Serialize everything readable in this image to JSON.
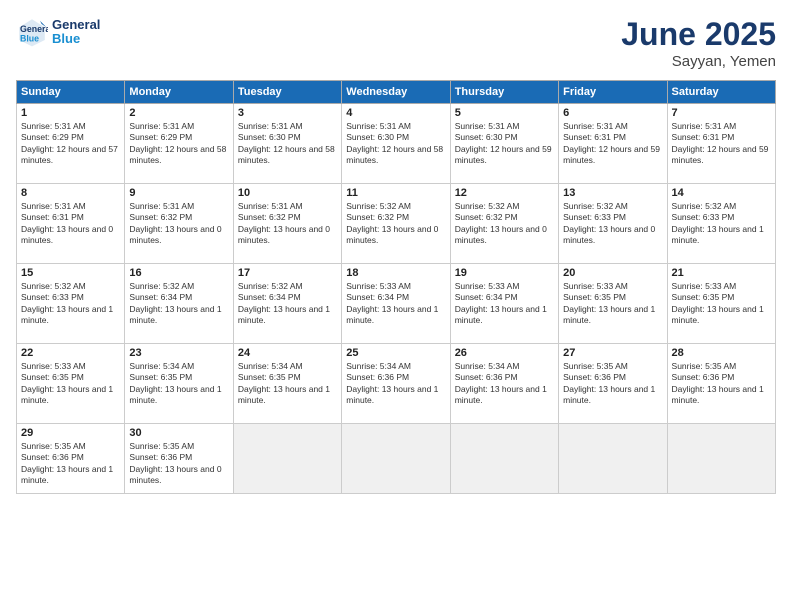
{
  "logo": {
    "line1": "General",
    "line2": "Blue"
  },
  "title": "June 2025",
  "location": "Sayyan, Yemen",
  "days_of_week": [
    "Sunday",
    "Monday",
    "Tuesday",
    "Wednesday",
    "Thursday",
    "Friday",
    "Saturday"
  ],
  "weeks": [
    [
      {
        "day": "1",
        "sunrise": "5:31 AM",
        "sunset": "6:29 PM",
        "daylight": "12 hours and 57 minutes."
      },
      {
        "day": "2",
        "sunrise": "5:31 AM",
        "sunset": "6:29 PM",
        "daylight": "12 hours and 58 minutes."
      },
      {
        "day": "3",
        "sunrise": "5:31 AM",
        "sunset": "6:30 PM",
        "daylight": "12 hours and 58 minutes."
      },
      {
        "day": "4",
        "sunrise": "5:31 AM",
        "sunset": "6:30 PM",
        "daylight": "12 hours and 58 minutes."
      },
      {
        "day": "5",
        "sunrise": "5:31 AM",
        "sunset": "6:30 PM",
        "daylight": "12 hours and 59 minutes."
      },
      {
        "day": "6",
        "sunrise": "5:31 AM",
        "sunset": "6:31 PM",
        "daylight": "12 hours and 59 minutes."
      },
      {
        "day": "7",
        "sunrise": "5:31 AM",
        "sunset": "6:31 PM",
        "daylight": "12 hours and 59 minutes."
      }
    ],
    [
      {
        "day": "8",
        "sunrise": "5:31 AM",
        "sunset": "6:31 PM",
        "daylight": "13 hours and 0 minutes."
      },
      {
        "day": "9",
        "sunrise": "5:31 AM",
        "sunset": "6:32 PM",
        "daylight": "13 hours and 0 minutes."
      },
      {
        "day": "10",
        "sunrise": "5:31 AM",
        "sunset": "6:32 PM",
        "daylight": "13 hours and 0 minutes."
      },
      {
        "day": "11",
        "sunrise": "5:32 AM",
        "sunset": "6:32 PM",
        "daylight": "13 hours and 0 minutes."
      },
      {
        "day": "12",
        "sunrise": "5:32 AM",
        "sunset": "6:32 PM",
        "daylight": "13 hours and 0 minutes."
      },
      {
        "day": "13",
        "sunrise": "5:32 AM",
        "sunset": "6:33 PM",
        "daylight": "13 hours and 0 minutes."
      },
      {
        "day": "14",
        "sunrise": "5:32 AM",
        "sunset": "6:33 PM",
        "daylight": "13 hours and 1 minute."
      }
    ],
    [
      {
        "day": "15",
        "sunrise": "5:32 AM",
        "sunset": "6:33 PM",
        "daylight": "13 hours and 1 minute."
      },
      {
        "day": "16",
        "sunrise": "5:32 AM",
        "sunset": "6:34 PM",
        "daylight": "13 hours and 1 minute."
      },
      {
        "day": "17",
        "sunrise": "5:32 AM",
        "sunset": "6:34 PM",
        "daylight": "13 hours and 1 minute."
      },
      {
        "day": "18",
        "sunrise": "5:33 AM",
        "sunset": "6:34 PM",
        "daylight": "13 hours and 1 minute."
      },
      {
        "day": "19",
        "sunrise": "5:33 AM",
        "sunset": "6:34 PM",
        "daylight": "13 hours and 1 minute."
      },
      {
        "day": "20",
        "sunrise": "5:33 AM",
        "sunset": "6:35 PM",
        "daylight": "13 hours and 1 minute."
      },
      {
        "day": "21",
        "sunrise": "5:33 AM",
        "sunset": "6:35 PM",
        "daylight": "13 hours and 1 minute."
      }
    ],
    [
      {
        "day": "22",
        "sunrise": "5:33 AM",
        "sunset": "6:35 PM",
        "daylight": "13 hours and 1 minute."
      },
      {
        "day": "23",
        "sunrise": "5:34 AM",
        "sunset": "6:35 PM",
        "daylight": "13 hours and 1 minute."
      },
      {
        "day": "24",
        "sunrise": "5:34 AM",
        "sunset": "6:35 PM",
        "daylight": "13 hours and 1 minute."
      },
      {
        "day": "25",
        "sunrise": "5:34 AM",
        "sunset": "6:36 PM",
        "daylight": "13 hours and 1 minute."
      },
      {
        "day": "26",
        "sunrise": "5:34 AM",
        "sunset": "6:36 PM",
        "daylight": "13 hours and 1 minute."
      },
      {
        "day": "27",
        "sunrise": "5:35 AM",
        "sunset": "6:36 PM",
        "daylight": "13 hours and 1 minute."
      },
      {
        "day": "28",
        "sunrise": "5:35 AM",
        "sunset": "6:36 PM",
        "daylight": "13 hours and 1 minute."
      }
    ],
    [
      {
        "day": "29",
        "sunrise": "5:35 AM",
        "sunset": "6:36 PM",
        "daylight": "13 hours and 1 minute."
      },
      {
        "day": "30",
        "sunrise": "5:35 AM",
        "sunset": "6:36 PM",
        "daylight": "13 hours and 0 minutes."
      },
      null,
      null,
      null,
      null,
      null
    ]
  ]
}
